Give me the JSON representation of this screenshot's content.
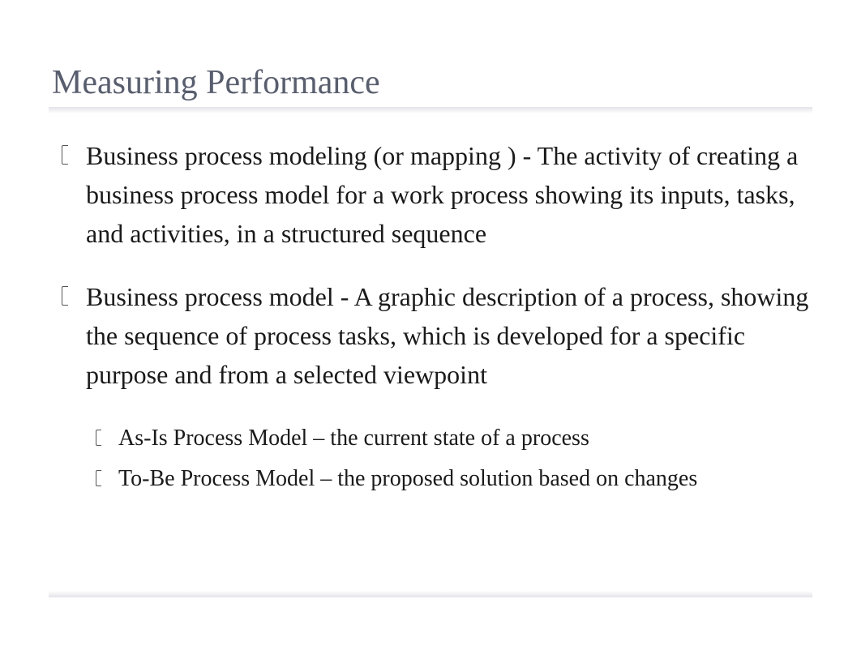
{
  "title": "Measuring Performance",
  "bullets": [
    {
      "text": "Business process modeling   (or mapping ) - The activity of creating a business process model for a work process showing its inputs, tasks, and activities, in a structured sequence"
    },
    {
      "text": "Business process model -   A graphic description of a process, showing the sequence of process tasks, which is developed for a specific purpose and from a selected viewpoint",
      "children": [
        {
          "text": "As-Is Process Model – the current state of a process"
        },
        {
          "text": "To-Be Process Model – the proposed solution based on changes"
        }
      ]
    }
  ]
}
